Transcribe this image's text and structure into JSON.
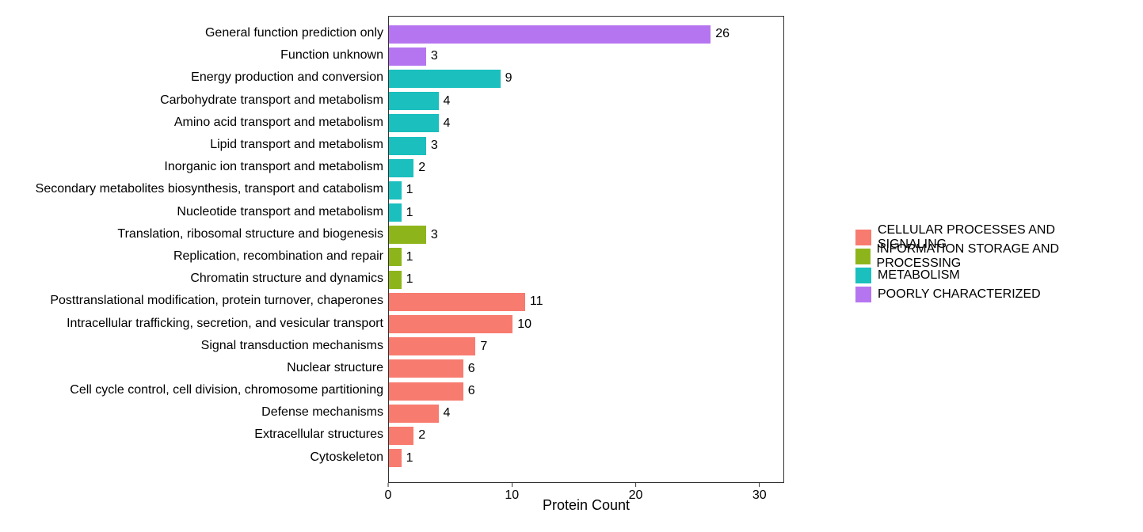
{
  "chart_data": {
    "type": "bar",
    "orientation": "horizontal",
    "xlabel": "Protein Count",
    "ylabel": "",
    "xlim": [
      0,
      32
    ],
    "x_ticks": [
      0,
      10,
      20,
      30
    ],
    "legend_position": "right",
    "groups": {
      "CELLULAR PROCESSES AND SIGNALING": "#f87b6f",
      "INFORMATION STORAGE AND PROCESSING": "#8db51b",
      "METABOLISM": "#1abfbe",
      "POORLY CHARACTERIZED": "#b675f0"
    },
    "categories": [
      {
        "label": "General function prediction only",
        "value": 26,
        "group": "POORLY CHARACTERIZED"
      },
      {
        "label": "Function unknown",
        "value": 3,
        "group": "POORLY CHARACTERIZED"
      },
      {
        "label": "Energy production and conversion",
        "value": 9,
        "group": "METABOLISM"
      },
      {
        "label": "Carbohydrate transport and metabolism",
        "value": 4,
        "group": "METABOLISM"
      },
      {
        "label": "Amino acid transport and metabolism",
        "value": 4,
        "group": "METABOLISM"
      },
      {
        "label": "Lipid transport and metabolism",
        "value": 3,
        "group": "METABOLISM"
      },
      {
        "label": "Inorganic ion transport and metabolism",
        "value": 2,
        "group": "METABOLISM"
      },
      {
        "label": "Secondary metabolites biosynthesis, transport and catabolism",
        "value": 1,
        "group": "METABOLISM"
      },
      {
        "label": "Nucleotide transport and metabolism",
        "value": 1,
        "group": "METABOLISM"
      },
      {
        "label": "Translation, ribosomal structure and biogenesis",
        "value": 3,
        "group": "INFORMATION STORAGE AND PROCESSING"
      },
      {
        "label": "Replication, recombination and repair",
        "value": 1,
        "group": "INFORMATION STORAGE AND PROCESSING"
      },
      {
        "label": "Chromatin structure and dynamics",
        "value": 1,
        "group": "INFORMATION STORAGE AND PROCESSING"
      },
      {
        "label": "Posttranslational modification, protein turnover, chaperones",
        "value": 11,
        "group": "CELLULAR PROCESSES AND SIGNALING"
      },
      {
        "label": "Intracellular trafficking, secretion, and vesicular transport",
        "value": 10,
        "group": "CELLULAR PROCESSES AND SIGNALING"
      },
      {
        "label": "Signal transduction mechanisms",
        "value": 7,
        "group": "CELLULAR PROCESSES AND SIGNALING"
      },
      {
        "label": "Nuclear structure",
        "value": 6,
        "group": "CELLULAR PROCESSES AND SIGNALING"
      },
      {
        "label": "Cell cycle control, cell division, chromosome partitioning",
        "value": 6,
        "group": "CELLULAR PROCESSES AND SIGNALING"
      },
      {
        "label": "Defense mechanisms",
        "value": 4,
        "group": "CELLULAR PROCESSES AND SIGNALING"
      },
      {
        "label": "Extracellular structures",
        "value": 2,
        "group": "CELLULAR PROCESSES AND SIGNALING"
      },
      {
        "label": "Cytoskeleton",
        "value": 1,
        "group": "CELLULAR PROCESSES AND SIGNALING"
      }
    ]
  }
}
